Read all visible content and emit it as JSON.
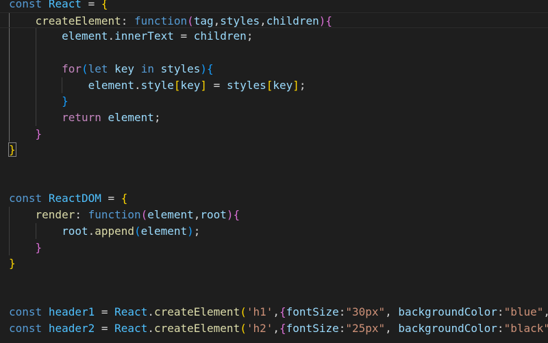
{
  "editor": {
    "theme_colors": {
      "background": "#1e1e1e",
      "keyword": "#569cd6",
      "variable": "#4fc1ff",
      "property": "#9cdcfe",
      "function": "#dcdcaa",
      "control": "#c586c0",
      "string": "#ce9178",
      "bracket_level1": "#ffd700",
      "bracket_level2": "#da70d6",
      "bracket_level3": "#179fff"
    },
    "lines": [
      [
        [
          "kw",
          "const"
        ],
        [
          "pl",
          " "
        ],
        [
          "var",
          "React"
        ],
        [
          "pl",
          " = "
        ],
        [
          "b1",
          "{"
        ]
      ],
      [
        [
          "pl",
          "    "
        ],
        [
          "fn",
          "createElement"
        ],
        [
          "pl",
          ": "
        ],
        [
          "kw",
          "function"
        ],
        [
          "b2",
          "("
        ],
        [
          "prop",
          "tag"
        ],
        [
          "pl",
          ","
        ],
        [
          "prop",
          "styles"
        ],
        [
          "pl",
          ","
        ],
        [
          "prop",
          "children"
        ],
        [
          "b2",
          ")"
        ],
        [
          "b2",
          "{"
        ]
      ],
      [
        [
          "pl",
          "        "
        ],
        [
          "prop",
          "element"
        ],
        [
          "pl",
          "."
        ],
        [
          "prop",
          "innerText"
        ],
        [
          "pl",
          " = "
        ],
        [
          "prop",
          "children"
        ],
        [
          "pl",
          ";"
        ]
      ],
      [],
      [
        [
          "pl",
          "        "
        ],
        [
          "ctl",
          "for"
        ],
        [
          "b3",
          "("
        ],
        [
          "kw",
          "let"
        ],
        [
          "pl",
          " "
        ],
        [
          "prop",
          "key"
        ],
        [
          "pl",
          " "
        ],
        [
          "kw",
          "in"
        ],
        [
          "pl",
          " "
        ],
        [
          "prop",
          "styles"
        ],
        [
          "b3",
          ")"
        ],
        [
          "b3",
          "{"
        ]
      ],
      [
        [
          "pl",
          "            "
        ],
        [
          "prop",
          "element"
        ],
        [
          "pl",
          "."
        ],
        [
          "prop",
          "style"
        ],
        [
          "b1",
          "["
        ],
        [
          "prop",
          "key"
        ],
        [
          "b1",
          "]"
        ],
        [
          "pl",
          " = "
        ],
        [
          "prop",
          "styles"
        ],
        [
          "b1",
          "["
        ],
        [
          "prop",
          "key"
        ],
        [
          "b1",
          "]"
        ],
        [
          "pl",
          ";"
        ]
      ],
      [
        [
          "pl",
          "        "
        ],
        [
          "b3",
          "}"
        ]
      ],
      [
        [
          "pl",
          "        "
        ],
        [
          "ctl",
          "return"
        ],
        [
          "pl",
          " "
        ],
        [
          "prop",
          "element"
        ],
        [
          "pl",
          ";"
        ]
      ],
      [
        [
          "pl",
          "    "
        ],
        [
          "b2",
          "}"
        ]
      ],
      [
        [
          "b1",
          "}"
        ]
      ],
      [],
      [],
      [
        [
          "kw",
          "const"
        ],
        [
          "pl",
          " "
        ],
        [
          "var",
          "ReactDOM"
        ],
        [
          "pl",
          " = "
        ],
        [
          "b1",
          "{"
        ]
      ],
      [
        [
          "pl",
          "    "
        ],
        [
          "fn",
          "render"
        ],
        [
          "pl",
          ": "
        ],
        [
          "kw",
          "function"
        ],
        [
          "b2",
          "("
        ],
        [
          "prop",
          "element"
        ],
        [
          "pl",
          ","
        ],
        [
          "prop",
          "root"
        ],
        [
          "b2",
          ")"
        ],
        [
          "b2",
          "{"
        ]
      ],
      [
        [
          "pl",
          "        "
        ],
        [
          "prop",
          "root"
        ],
        [
          "pl",
          "."
        ],
        [
          "fn",
          "append"
        ],
        [
          "b3",
          "("
        ],
        [
          "prop",
          "element"
        ],
        [
          "b3",
          ")"
        ],
        [
          "pl",
          ";"
        ]
      ],
      [
        [
          "pl",
          "    "
        ],
        [
          "b2",
          "}"
        ]
      ],
      [
        [
          "b1",
          "}"
        ]
      ],
      [],
      [],
      [
        [
          "kw",
          "const"
        ],
        [
          "pl",
          " "
        ],
        [
          "var",
          "header1"
        ],
        [
          "pl",
          " = "
        ],
        [
          "var",
          "React"
        ],
        [
          "pl",
          "."
        ],
        [
          "fn",
          "createElement"
        ],
        [
          "b1",
          "("
        ],
        [
          "str",
          "'h1'"
        ],
        [
          "pl",
          ","
        ],
        [
          "b2",
          "{"
        ],
        [
          "prop",
          "fontSize"
        ],
        [
          "pl",
          ":"
        ],
        [
          "str",
          "\"30px\""
        ],
        [
          "pl",
          ", "
        ],
        [
          "prop",
          "backgroundColor"
        ],
        [
          "pl",
          ":"
        ],
        [
          "str",
          "\"blue\""
        ],
        [
          "pl",
          ","
        ]
      ],
      [
        [
          "kw",
          "const"
        ],
        [
          "pl",
          " "
        ],
        [
          "var",
          "header2"
        ],
        [
          "pl",
          " = "
        ],
        [
          "var",
          "React"
        ],
        [
          "pl",
          "."
        ],
        [
          "fn",
          "createElement"
        ],
        [
          "b1",
          "("
        ],
        [
          "str",
          "'h2'"
        ],
        [
          "pl",
          ","
        ],
        [
          "b2",
          "{"
        ],
        [
          "prop",
          "fontSize"
        ],
        [
          "pl",
          ":"
        ],
        [
          "str",
          "\"25px\""
        ],
        [
          "pl",
          ", "
        ],
        [
          "prop",
          "backgroundColor"
        ],
        [
          "pl",
          ":"
        ],
        [
          "str",
          "\"black\""
        ]
      ]
    ]
  }
}
